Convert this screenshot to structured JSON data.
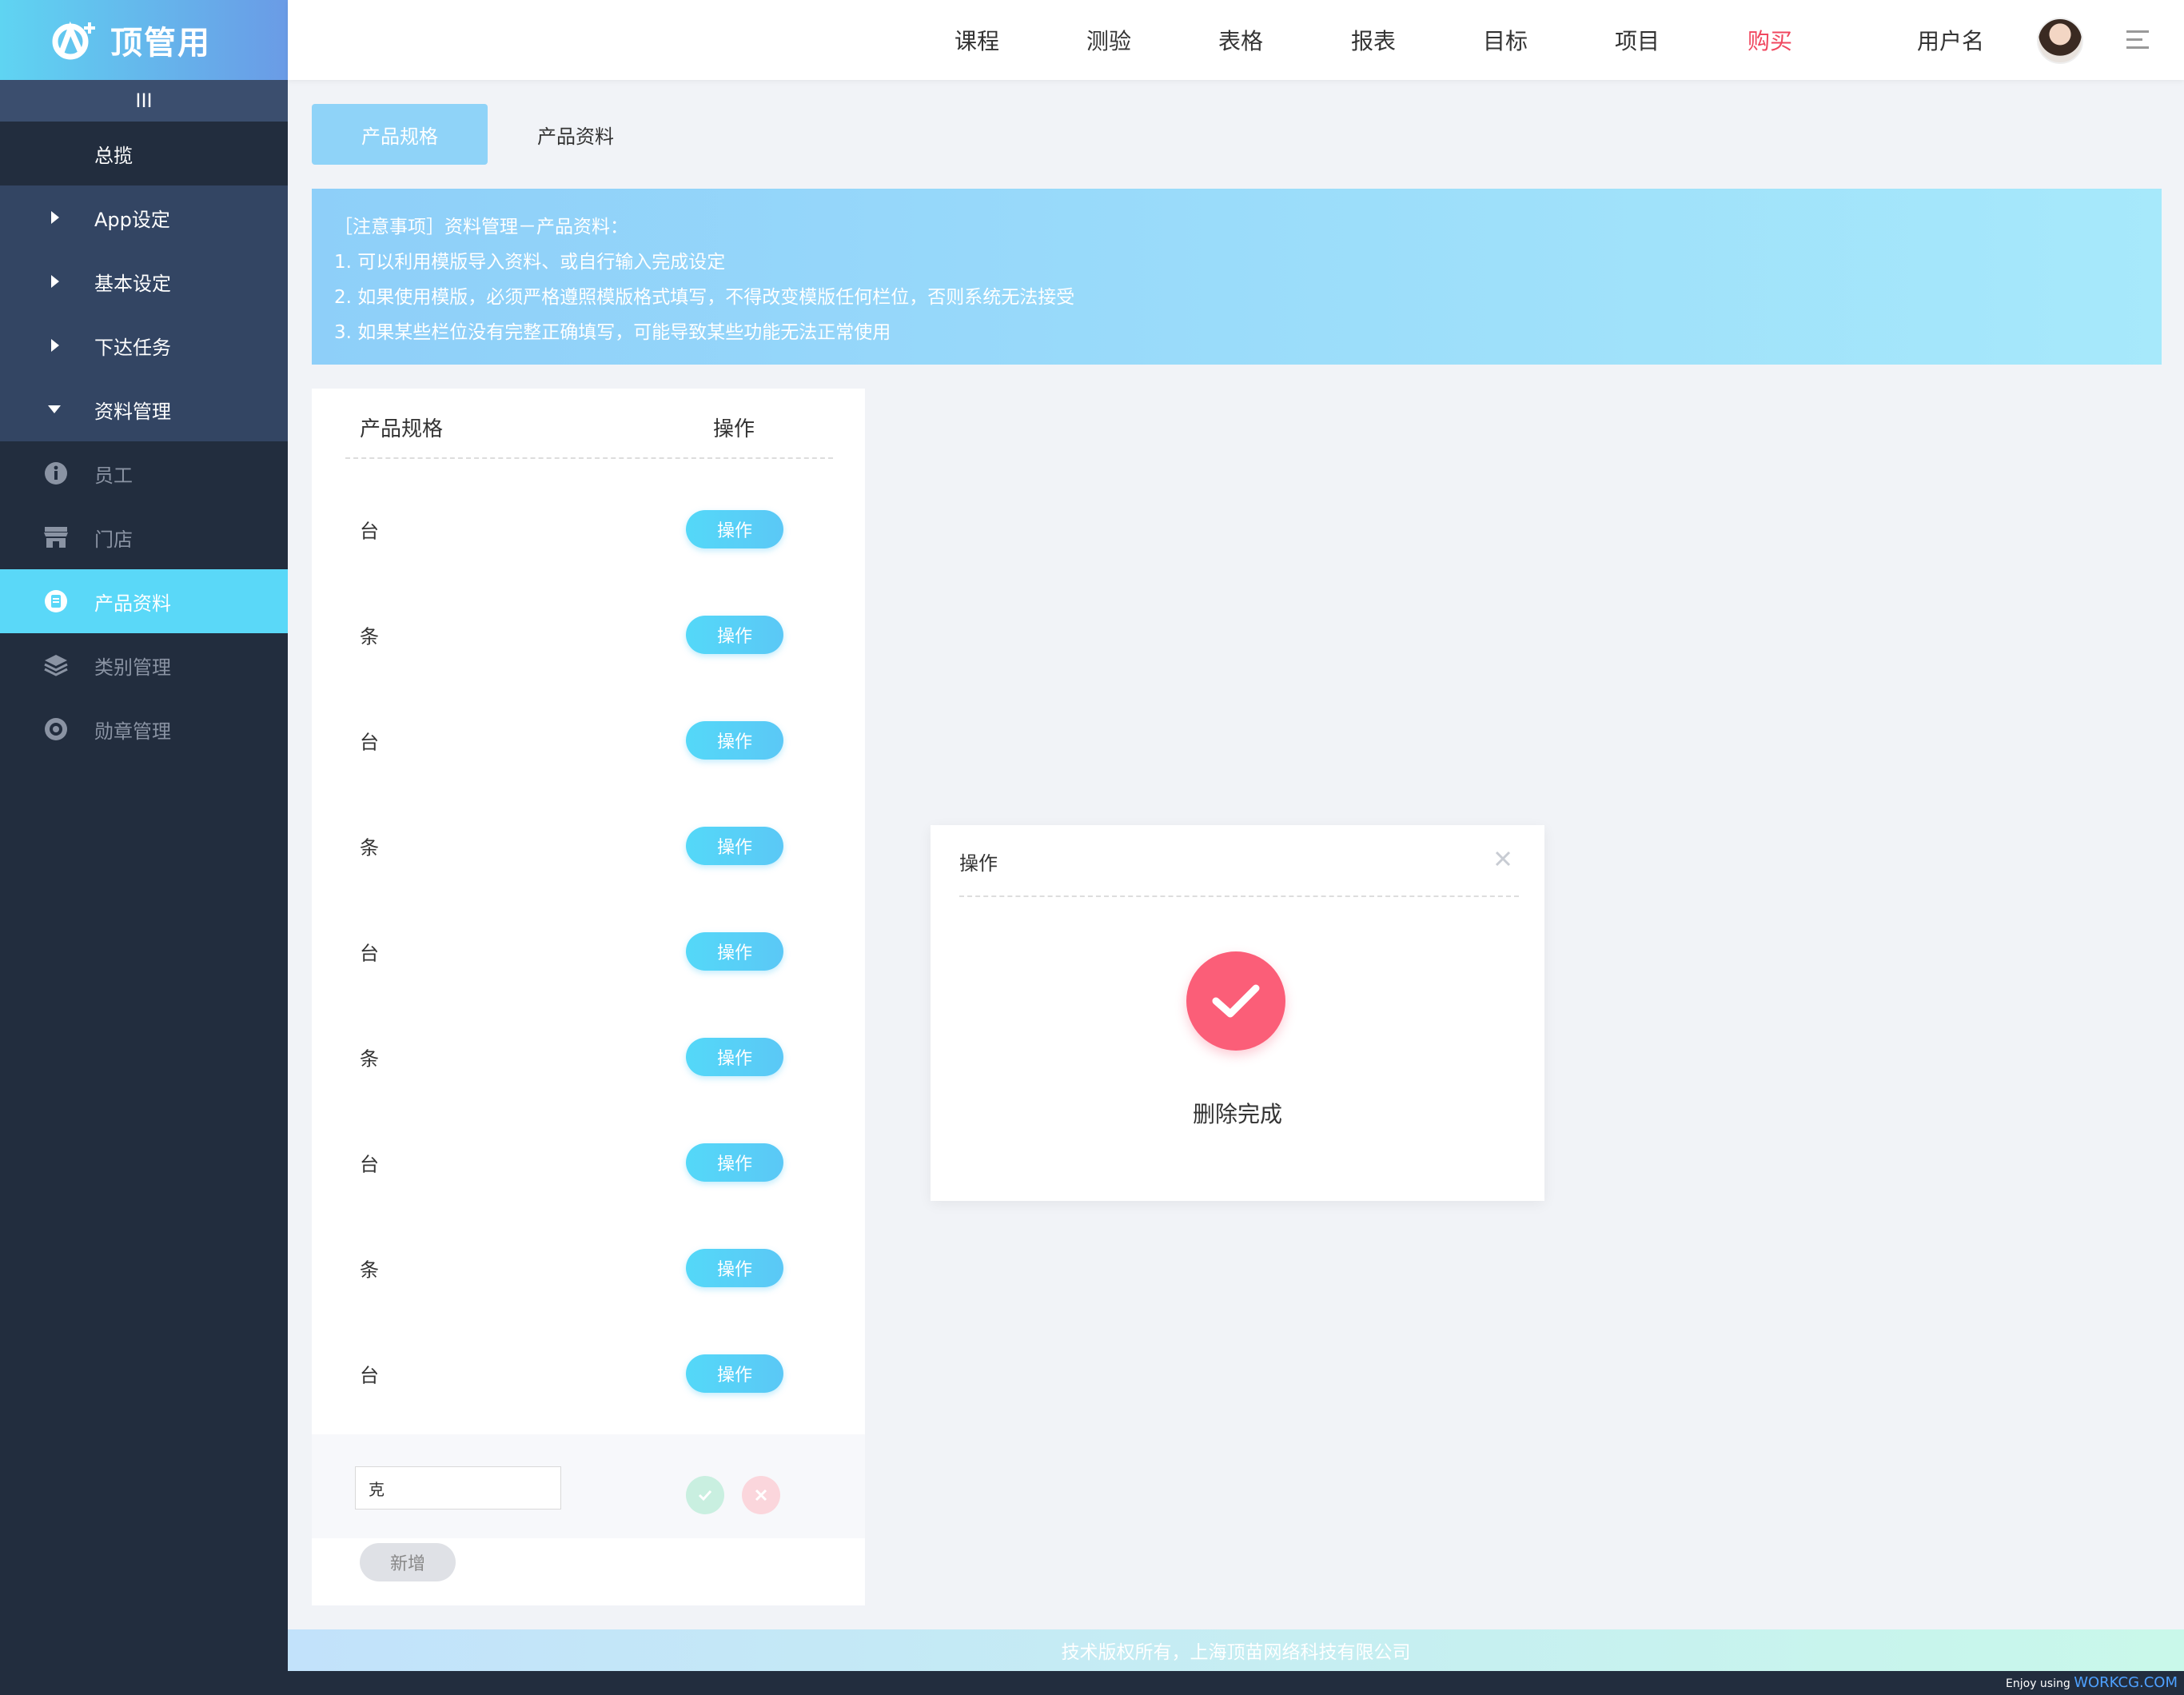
{
  "brand": {
    "name": "顶管用"
  },
  "sidebar": {
    "collapse_label": "III",
    "items": [
      {
        "label": "总揽"
      },
      {
        "label": "App设定"
      },
      {
        "label": "基本设定"
      },
      {
        "label": "下达任务"
      },
      {
        "label": "资料管理"
      },
      {
        "label": "员工"
      },
      {
        "label": "门店"
      },
      {
        "label": "产品资料"
      },
      {
        "label": "类别管理"
      },
      {
        "label": "勋章管理"
      }
    ]
  },
  "header": {
    "nav": [
      "课程",
      "测验",
      "表格",
      "报表",
      "目标",
      "项目",
      "购买"
    ],
    "username": "用户名",
    "accent_color": "#f0475f"
  },
  "tabs": {
    "active": "产品规格",
    "other": "产品资料"
  },
  "notice": {
    "lines": [
      "［注意事项］资料管理－产品资料：",
      "1. 可以利用模版导入资料、或自行输入完成设定",
      "2. 如果使用模版，必须严格遵照模版格式填写，不得改变模版任何栏位，否则系统无法接受",
      "3. 如果某些栏位没有完整正确填写，可能导致某些功能无法正常使用"
    ]
  },
  "table": {
    "headers": {
      "spec": "产品规格",
      "action": "操作"
    },
    "rows": [
      "台",
      "条",
      "台",
      "条",
      "台",
      "条",
      "台",
      "条",
      "台"
    ],
    "row_action_label": "操作",
    "edit_value": "克",
    "add_label": "新增"
  },
  "modal": {
    "title": "操作",
    "message": "删除完成"
  },
  "footer": {
    "copyright": "技术版权所有，上海顶苗网络科技有限公司"
  },
  "credit": {
    "prefix": "Enjoy using",
    "site": "WORKCG.COM"
  }
}
